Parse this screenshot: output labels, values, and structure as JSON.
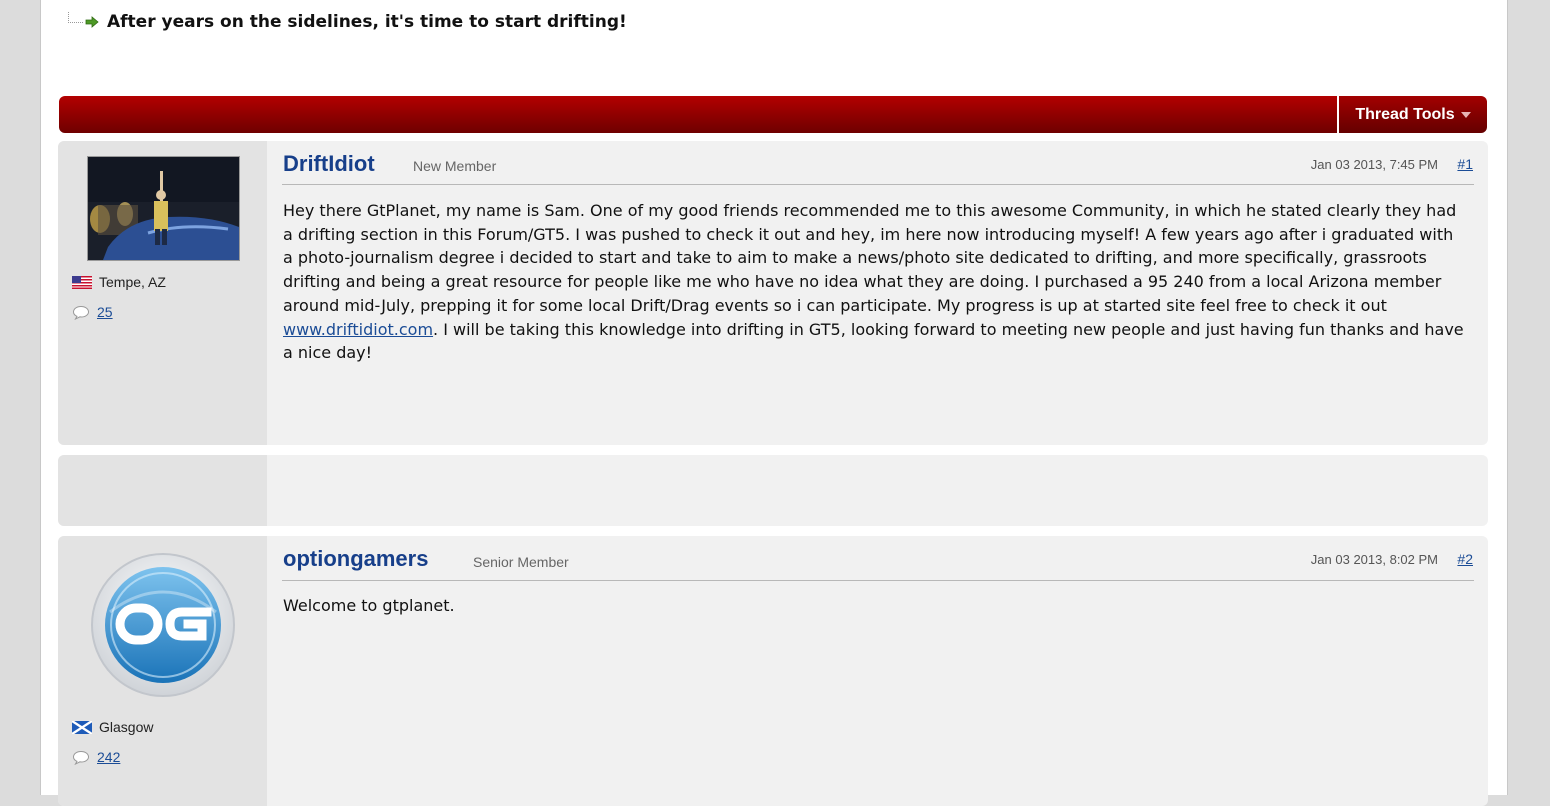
{
  "thread": {
    "title": "After years on the sidelines, it's time to start drifting!",
    "tools_label": "Thread Tools"
  },
  "posts": [
    {
      "username": "DriftIdiot",
      "rank": "New Member",
      "date": "Jan 03 2013, 7:45 PM",
      "number": "#1",
      "location": "Tempe, AZ",
      "post_count": "25",
      "flag_icon": "us-flag-icon",
      "body_pre": "Hey there GtPlanet, my name is Sam. One of my good friends recommended me to this awesome Community, in which he stated clearly they had a drifting section in this Forum/GT5. I was pushed to check it out and hey, im here now introducing myself! A few years ago after i graduated with a photo-journalism degree i decided to start and take to aim to make a news/photo site dedicated to drifting, and more specifically, grassroots drifting and being a great resource for people like me who have no idea what they are doing. I purchased a 95 240 from a local Arizona member around mid-July, prepping it for some local Drift/Drag events so i can participate. My progress is up at started site feel free to check it out ",
      "link": "www.driftidiot.com",
      "body_post": ". I will be taking this knowledge into drifting in GT5, looking forward to meeting new people and just having fun thanks and have a nice day!"
    },
    {
      "username": "optiongamers",
      "rank": "Senior Member",
      "date": "Jan 03 2013, 8:02 PM",
      "number": "#2",
      "location": "Glasgow",
      "post_count": "242",
      "flag_icon": "scotland-flag-icon",
      "body": "Welcome to gtplanet."
    }
  ],
  "colors": {
    "bar_red": "#8d0000",
    "username_blue": "#173f8a",
    "link_blue": "#1b4c96"
  }
}
